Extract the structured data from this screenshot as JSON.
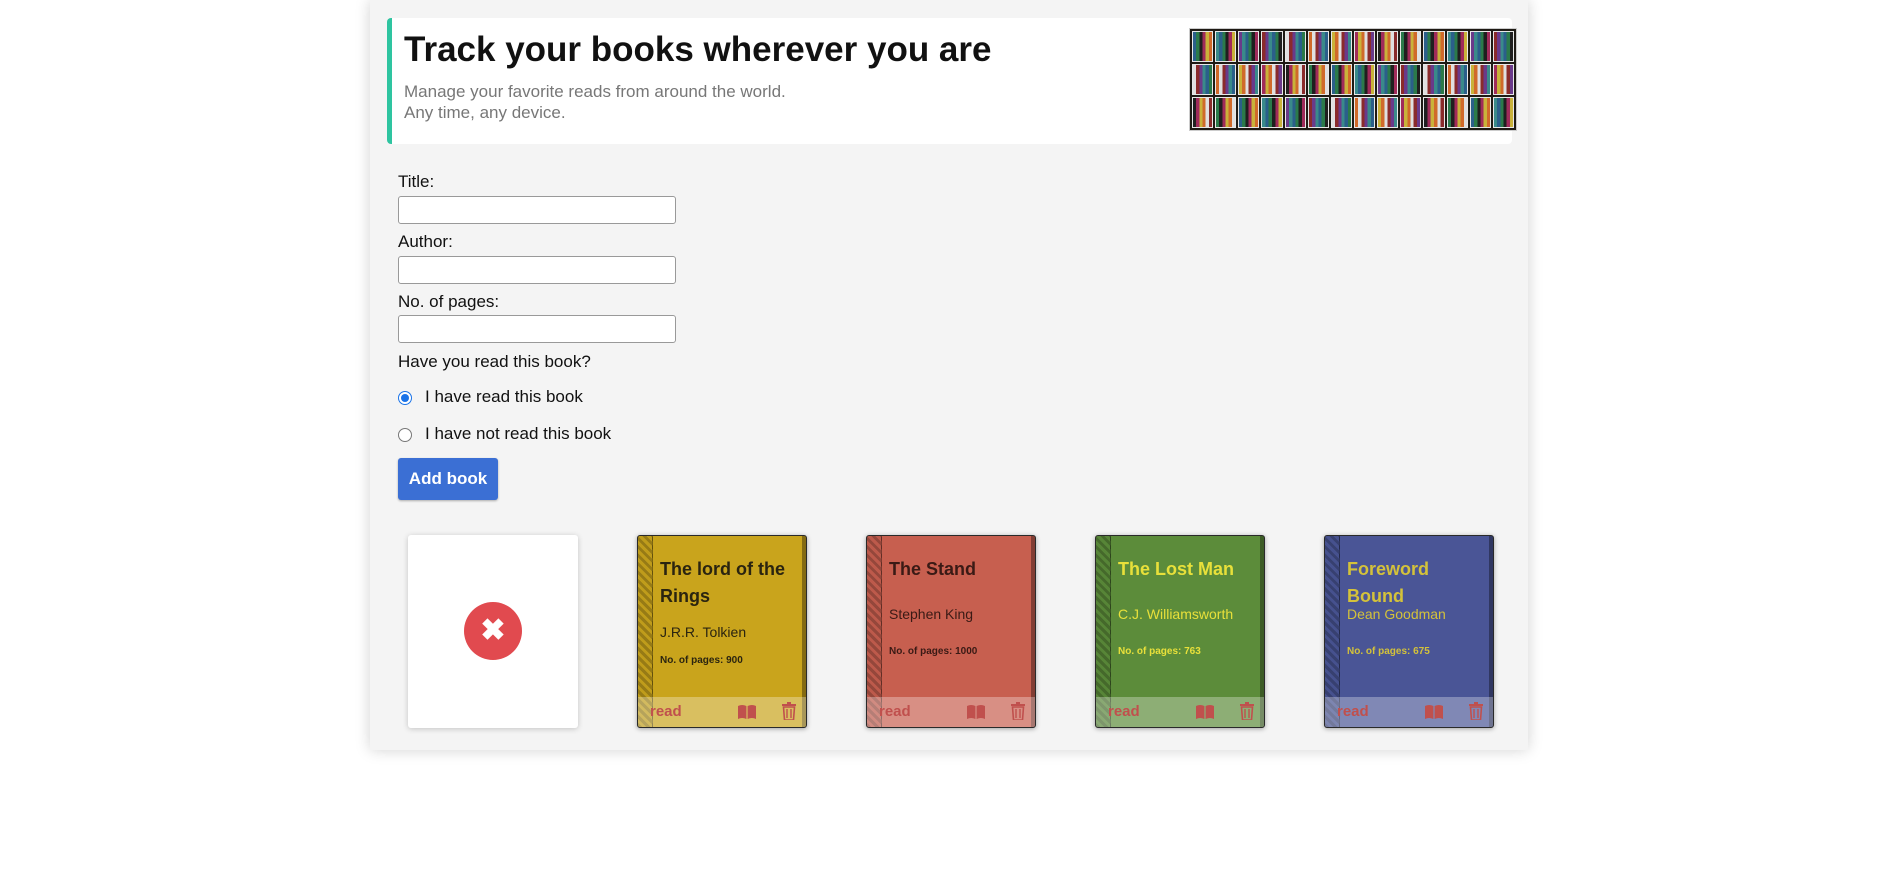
{
  "hero": {
    "title": "Track your books wherever you are",
    "subtitle_line1": "Manage your favorite reads from around the world.",
    "subtitle_line2": "Any time, any device."
  },
  "form": {
    "title_label": "Title:",
    "author_label": "Author:",
    "pages_label": "No. of pages:",
    "title_value": "",
    "author_value": "",
    "pages_value": "",
    "read_question": "Have you read this book?",
    "radio_read_label": "I have read this book",
    "radio_not_read_label": "I have not read this book",
    "selected": "read",
    "add_button": "Add book"
  },
  "close_icon_glyph": "✖",
  "books": [
    {
      "title": "The lord of the Rings",
      "author": "J.R.R. Tolkien",
      "pages": "No. of pages: 900",
      "status": "read",
      "color": "#c9a41c",
      "text_color": "#2a2410"
    },
    {
      "title": "The Stand",
      "author": "Stephen King",
      "pages": "No. of pages: 1000",
      "status": "read",
      "color": "#c75f4f",
      "text_color": "#3a1a15"
    },
    {
      "title": "The Lost Man",
      "author": "C.J. Williamsworth",
      "pages": "No. of pages: 763",
      "status": "read",
      "color": "#5c8c3a",
      "text_color": "#e8e03a"
    },
    {
      "title": "Foreword Bound",
      "author": "Dean Goodman",
      "pages": "No. of pages: 675",
      "status": "read",
      "color": "#4a5596",
      "text_color": "#d4c23a"
    }
  ],
  "icons": {
    "open_book": "book-open-icon",
    "trash": "trash-icon",
    "close": "close-icon"
  },
  "colors": {
    "accent": "#2ec4a0",
    "button": "#3b6fd4",
    "danger": "#e14a4f",
    "icon_red": "#c0504d"
  }
}
